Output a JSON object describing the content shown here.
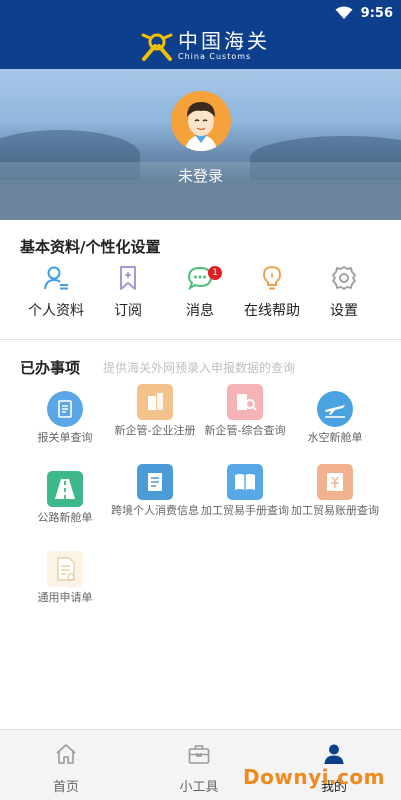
{
  "status_bar": {
    "time": "9:56"
  },
  "header": {
    "logo_cn": "中国海关",
    "logo_en": "China Customs"
  },
  "profile": {
    "login_status": "未登录"
  },
  "basic_section": {
    "title": "基本资料/个性化设置",
    "items": [
      {
        "label": "个人资料",
        "icon": "person-icon"
      },
      {
        "label": "订阅",
        "icon": "bookmark-icon"
      },
      {
        "label": "消息",
        "icon": "message-icon",
        "badge": "1"
      },
      {
        "label": "在线帮助",
        "icon": "lightbulb-icon"
      },
      {
        "label": "设置",
        "icon": "gear-icon"
      }
    ]
  },
  "done_section": {
    "title": "已办事项",
    "subtitle": "提供海关外网预录入申报数据的查询",
    "items": [
      {
        "label": "报关单查询",
        "icon": "document-icon",
        "color": "#5aa6e6"
      },
      {
        "label": "新企管-企业注册",
        "icon": "building-icon",
        "color": "#f4c28c"
      },
      {
        "label": "新企管-综合查询",
        "icon": "building-search-icon",
        "color": "#f6b3b6"
      },
      {
        "label": "水空新舱单",
        "icon": "airplane-icon",
        "color": "#4aa2e0"
      },
      {
        "label": "公路新舱单",
        "icon": "road-icon",
        "color": "#3db88a"
      },
      {
        "label": "跨境个人消费信息",
        "icon": "receipt-icon",
        "color": "#4a9bd8"
      },
      {
        "label": "加工贸易手册查询",
        "icon": "book-icon",
        "color": "#56a9e6"
      },
      {
        "label": "加工贸易账册查询",
        "icon": "ledger-icon",
        "color": "#f3b28f"
      },
      {
        "label": "通用申请单",
        "icon": "form-icon",
        "color": "#f1dfc0"
      }
    ]
  },
  "bottom_nav": {
    "items": [
      {
        "label": "首页",
        "icon": "home-icon"
      },
      {
        "label": "小工具",
        "icon": "toolbox-icon"
      },
      {
        "label": "我的",
        "icon": "user-icon"
      }
    ]
  },
  "watermark": "Downyi.com"
}
